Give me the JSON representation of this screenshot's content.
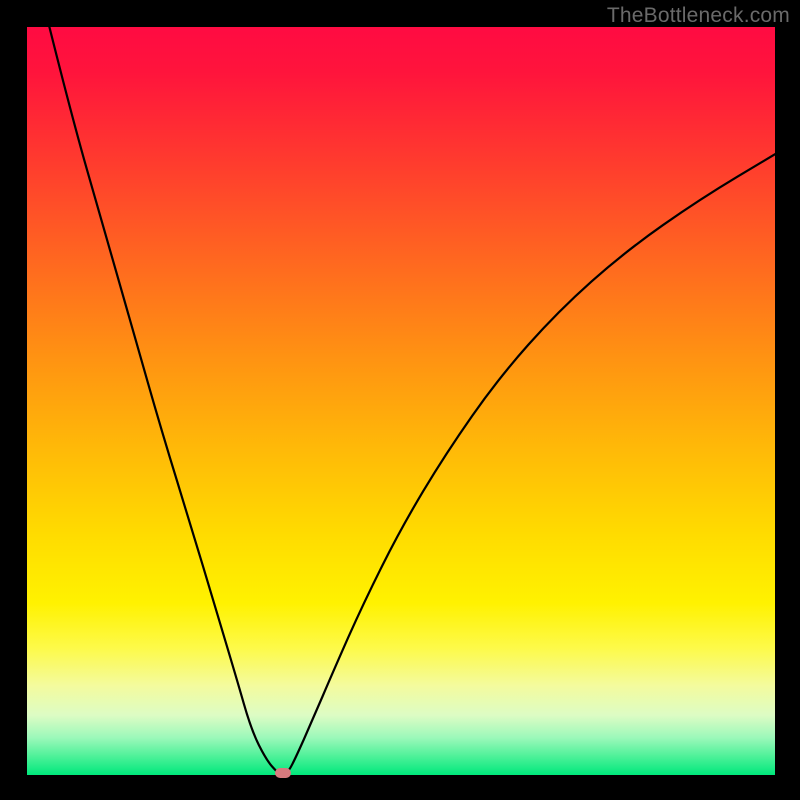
{
  "watermark": "TheBottleneck.com",
  "chart_data": {
    "type": "line",
    "title": "",
    "xlabel": "",
    "ylabel": "",
    "xlim": [
      0,
      100
    ],
    "ylim": [
      0,
      100
    ],
    "grid": false,
    "background_gradient": [
      "#ff0b42",
      "#ffdc00",
      "#00e87c"
    ],
    "series": [
      {
        "name": "bottleneck-curve",
        "x": [
          3,
          6,
          10,
          14,
          18,
          22,
          25,
          28,
          30,
          32,
          33.5,
          34.2,
          35,
          36,
          38,
          41,
          45,
          50,
          56,
          63,
          71,
          80,
          90,
          100
        ],
        "y": [
          100,
          88,
          74,
          60,
          46,
          33,
          23,
          13,
          6,
          2,
          0.3,
          0,
          0.5,
          2.5,
          7,
          14,
          23,
          33,
          43,
          53,
          62,
          70,
          77,
          83
        ]
      }
    ],
    "marker": {
      "x": 34.2,
      "y": 0,
      "color": "#d77a7e"
    }
  }
}
